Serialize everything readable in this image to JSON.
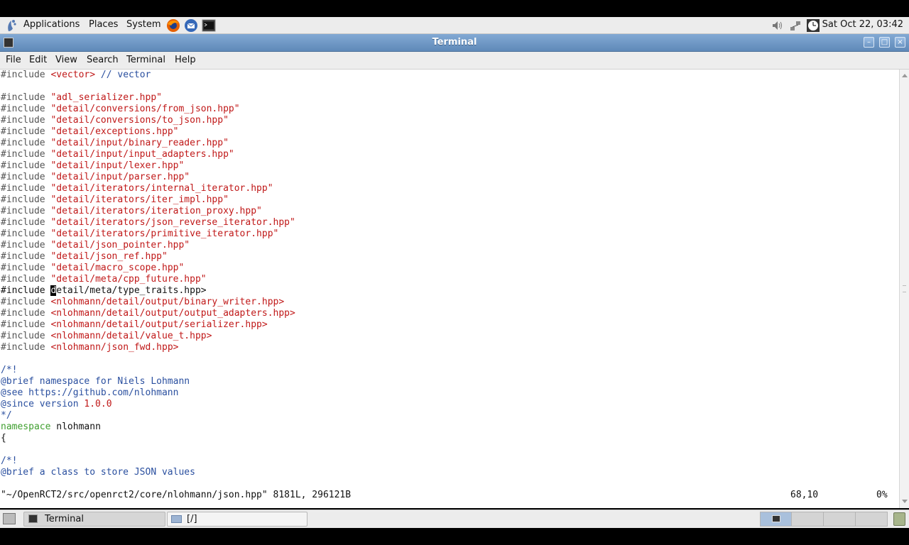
{
  "top_panel": {
    "menus": [
      "Applications",
      "Places",
      "System"
    ],
    "clock": "Sat Oct 22, 03:42",
    "launcher_icons": [
      "firefox-icon",
      "thunderbird-icon",
      "terminal-icon"
    ],
    "tray_icons": [
      "volume-icon",
      "network-icon",
      "clock-icon"
    ]
  },
  "window": {
    "title": "Terminal",
    "menu": [
      "File",
      "Edit",
      "View",
      "Search",
      "Terminal",
      "Help"
    ]
  },
  "editor": {
    "lines": [
      {
        "segments": [
          {
            "text": "#include ",
            "style": "gray"
          },
          {
            "text": "<vector>",
            "style": "red"
          },
          {
            "text": " // vector",
            "style": "blue"
          }
        ]
      },
      {
        "segments": []
      },
      {
        "segments": [
          {
            "text": "#include ",
            "style": "gray"
          },
          {
            "text": "\"adl_serializer.hpp\"",
            "style": "red"
          }
        ]
      },
      {
        "segments": [
          {
            "text": "#include ",
            "style": "gray"
          },
          {
            "text": "\"detail/conversions/from_json.hpp\"",
            "style": "red"
          }
        ]
      },
      {
        "segments": [
          {
            "text": "#include ",
            "style": "gray"
          },
          {
            "text": "\"detail/conversions/to_json.hpp\"",
            "style": "red"
          }
        ]
      },
      {
        "segments": [
          {
            "text": "#include ",
            "style": "gray"
          },
          {
            "text": "\"detail/exceptions.hpp\"",
            "style": "red"
          }
        ]
      },
      {
        "segments": [
          {
            "text": "#include ",
            "style": "gray"
          },
          {
            "text": "\"detail/input/binary_reader.hpp\"",
            "style": "red"
          }
        ]
      },
      {
        "segments": [
          {
            "text": "#include ",
            "style": "gray"
          },
          {
            "text": "\"detail/input/input_adapters.hpp\"",
            "style": "red"
          }
        ]
      },
      {
        "segments": [
          {
            "text": "#include ",
            "style": "gray"
          },
          {
            "text": "\"detail/input/lexer.hpp\"",
            "style": "red"
          }
        ]
      },
      {
        "segments": [
          {
            "text": "#include ",
            "style": "gray"
          },
          {
            "text": "\"detail/input/parser.hpp\"",
            "style": "red"
          }
        ]
      },
      {
        "segments": [
          {
            "text": "#include ",
            "style": "gray"
          },
          {
            "text": "\"detail/iterators/internal_iterator.hpp\"",
            "style": "red"
          }
        ]
      },
      {
        "segments": [
          {
            "text": "#include ",
            "style": "gray"
          },
          {
            "text": "\"detail/iterators/iter_impl.hpp\"",
            "style": "red"
          }
        ]
      },
      {
        "segments": [
          {
            "text": "#include ",
            "style": "gray"
          },
          {
            "text": "\"detail/iterators/iteration_proxy.hpp\"",
            "style": "red"
          }
        ]
      },
      {
        "segments": [
          {
            "text": "#include ",
            "style": "gray"
          },
          {
            "text": "\"detail/iterators/json_reverse_iterator.hpp\"",
            "style": "red"
          }
        ]
      },
      {
        "segments": [
          {
            "text": "#include ",
            "style": "gray"
          },
          {
            "text": "\"detail/iterators/primitive_iterator.hpp\"",
            "style": "red"
          }
        ]
      },
      {
        "segments": [
          {
            "text": "#include ",
            "style": "gray"
          },
          {
            "text": "\"detail/json_pointer.hpp\"",
            "style": "red"
          }
        ]
      },
      {
        "segments": [
          {
            "text": "#include ",
            "style": "gray"
          },
          {
            "text": "\"detail/json_ref.hpp\"",
            "style": "red"
          }
        ]
      },
      {
        "segments": [
          {
            "text": "#include ",
            "style": "gray"
          },
          {
            "text": "\"detail/macro_scope.hpp\"",
            "style": "red"
          }
        ]
      },
      {
        "segments": [
          {
            "text": "#include ",
            "style": "gray"
          },
          {
            "text": "\"detail/meta/cpp_future.hpp\"",
            "style": "red"
          }
        ]
      },
      {
        "segments": [
          {
            "text": "#include ",
            "style": "plain"
          },
          {
            "text": "d",
            "style": "cursor"
          },
          {
            "text": "etail/meta/type_traits.hpp>",
            "style": "plain"
          }
        ]
      },
      {
        "segments": [
          {
            "text": "#include ",
            "style": "gray"
          },
          {
            "text": "<nlohmann/detail/output/binary_writer.hpp>",
            "style": "red"
          }
        ]
      },
      {
        "segments": [
          {
            "text": "#include ",
            "style": "gray"
          },
          {
            "text": "<nlohmann/detail/output/output_adapters.hpp>",
            "style": "red"
          }
        ]
      },
      {
        "segments": [
          {
            "text": "#include ",
            "style": "gray"
          },
          {
            "text": "<nlohmann/detail/output/serializer.hpp>",
            "style": "red"
          }
        ]
      },
      {
        "segments": [
          {
            "text": "#include ",
            "style": "gray"
          },
          {
            "text": "<nlohmann/detail/value_t.hpp>",
            "style": "red"
          }
        ]
      },
      {
        "segments": [
          {
            "text": "#include ",
            "style": "gray"
          },
          {
            "text": "<nlohmann/json_fwd.hpp>",
            "style": "red"
          }
        ]
      },
      {
        "segments": []
      },
      {
        "segments": [
          {
            "text": "/*!",
            "style": "blue"
          }
        ]
      },
      {
        "segments": [
          {
            "text": "@brief namespace for Niels Lohmann",
            "style": "blue"
          }
        ]
      },
      {
        "segments": [
          {
            "text": "@see https://github.com/nlohmann",
            "style": "blue"
          }
        ]
      },
      {
        "segments": [
          {
            "text": "@since version ",
            "style": "blue"
          },
          {
            "text": "1.0.0",
            "style": "red"
          }
        ]
      },
      {
        "segments": [
          {
            "text": "*/",
            "style": "blue"
          }
        ]
      },
      {
        "segments": [
          {
            "text": "namespace",
            "style": "green"
          },
          {
            "text": " nlohmann",
            "style": "plain"
          }
        ]
      },
      {
        "segments": [
          {
            "text": "{",
            "style": "plain"
          }
        ]
      },
      {
        "segments": []
      },
      {
        "segments": [
          {
            "text": "/*!",
            "style": "blue"
          }
        ]
      },
      {
        "segments": [
          {
            "text": "@brief a class to store JSON values",
            "style": "blue"
          }
        ]
      }
    ],
    "status_file": "\"~/OpenRCT2/src/openrct2/core/nlohmann/json.hpp\" 8181L, 296121B",
    "status_position": "68,10",
    "status_percent": "0%"
  },
  "taskbar": {
    "items": [
      {
        "label": "Terminal",
        "active": true
      },
      {
        "label": "[/]",
        "active": false
      }
    ]
  }
}
